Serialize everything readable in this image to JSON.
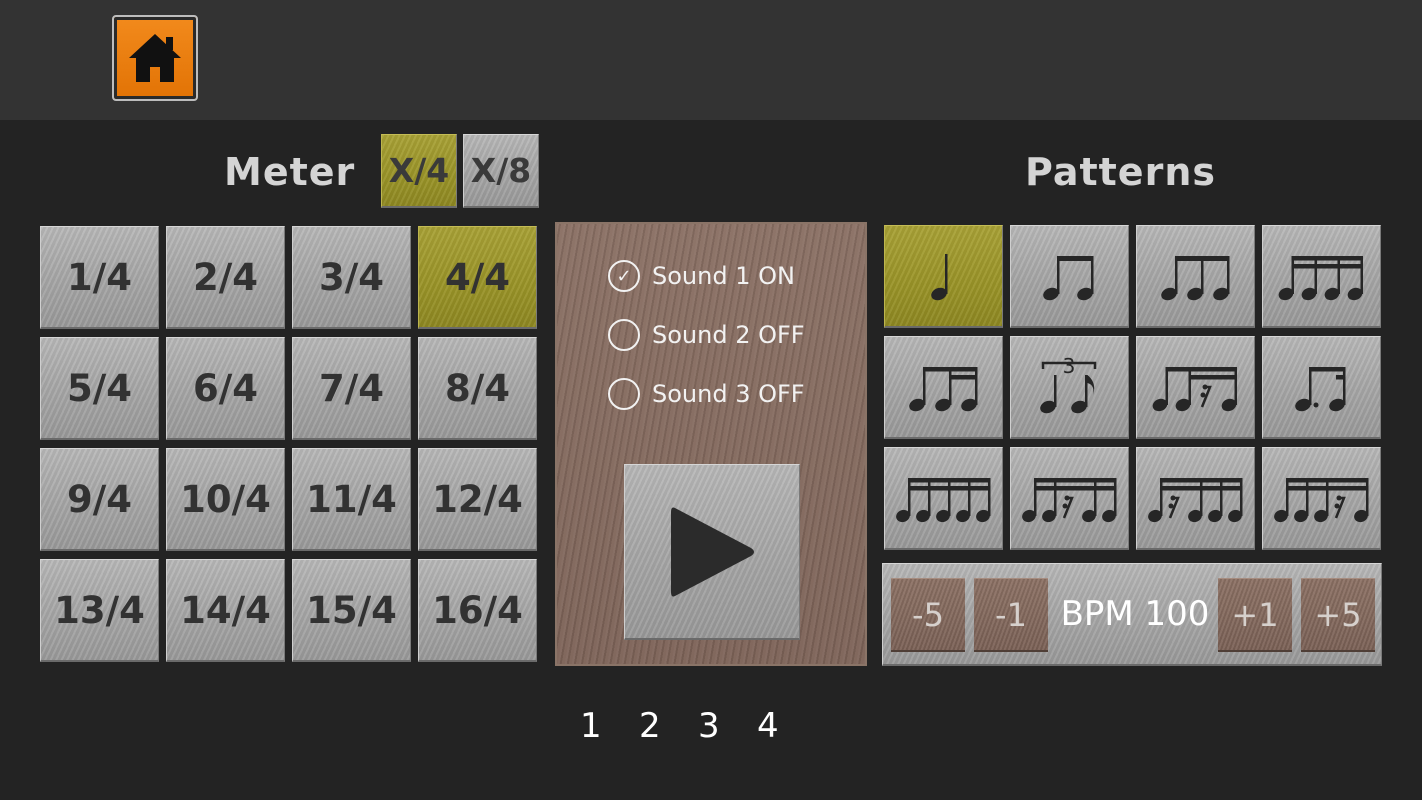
{
  "toolbar": {
    "home_icon": "home-icon"
  },
  "meter": {
    "heading": "Meter",
    "toggles": [
      {
        "label": "X/4",
        "selected": true
      },
      {
        "label": "X/8",
        "selected": false
      }
    ],
    "buttons": [
      "1/4",
      "2/4",
      "3/4",
      "4/4",
      "5/4",
      "6/4",
      "7/4",
      "8/4",
      "9/4",
      "10/4",
      "11/4",
      "12/4",
      "13/4",
      "14/4",
      "15/4",
      "16/4"
    ],
    "selected": "4/4"
  },
  "sounds": [
    {
      "label": "Sound 1 ON",
      "on": true
    },
    {
      "label": "Sound 2 OFF",
      "on": false
    },
    {
      "label": "Sound 3 OFF",
      "on": false
    }
  ],
  "player": {
    "play_icon": "play-icon"
  },
  "patterns": {
    "heading": "Patterns",
    "items": [
      "quarter-note-icon",
      "two-eighth-notes-icon",
      "eighth-note-triplet-icon",
      "four-sixteenth-notes-icon",
      "eighth-two-sixteenths-icon",
      "quarter-eighth-triplet-icon",
      "sixteenth-pattern-with-rest-icon",
      "dotted-eighth-sixteenth-icon",
      "quintuplet-sixteenths-icon",
      "quintuplet-with-rest-2-icon",
      "quintuplet-with-rest-1-icon",
      "quintuplet-with-rest-4-icon"
    ],
    "selected_index": 0
  },
  "bpm": {
    "minus5": "-5",
    "minus1": "-1",
    "label": "BPM 100",
    "plus1": "+1",
    "plus5": "+5"
  },
  "pages": [
    "1",
    "2",
    "3",
    "4"
  ],
  "colors": {
    "home_orange": "#e98012",
    "selected_olive": "#9a9428",
    "metal_gray": "#a8a8a8",
    "wood_brown": "#806659"
  }
}
